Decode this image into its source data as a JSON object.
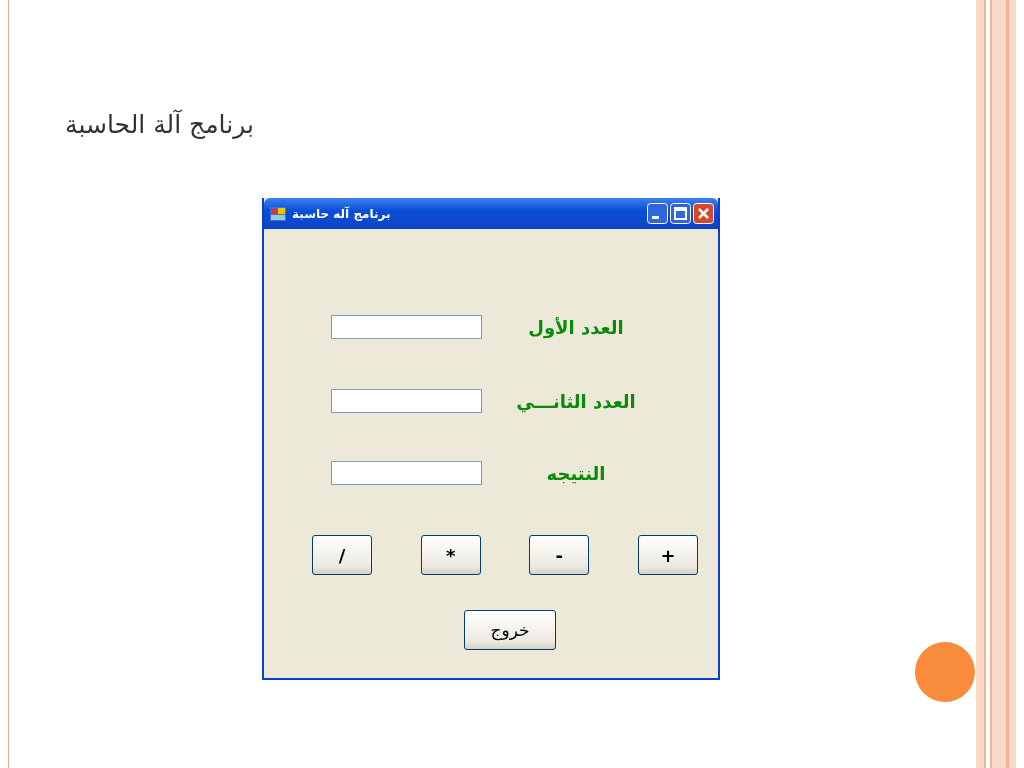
{
  "slide": {
    "title": "برنامج آلة الحاسبة"
  },
  "window": {
    "title": "برنامج آله حاسبة",
    "fields": [
      {
        "label": "العدد الأول"
      },
      {
        "label": "العدد الثانـــي"
      },
      {
        "label": "النتيجه"
      }
    ],
    "operator_buttons": [
      "+",
      "-",
      "*",
      "/"
    ],
    "exit_button": "خروج"
  }
}
